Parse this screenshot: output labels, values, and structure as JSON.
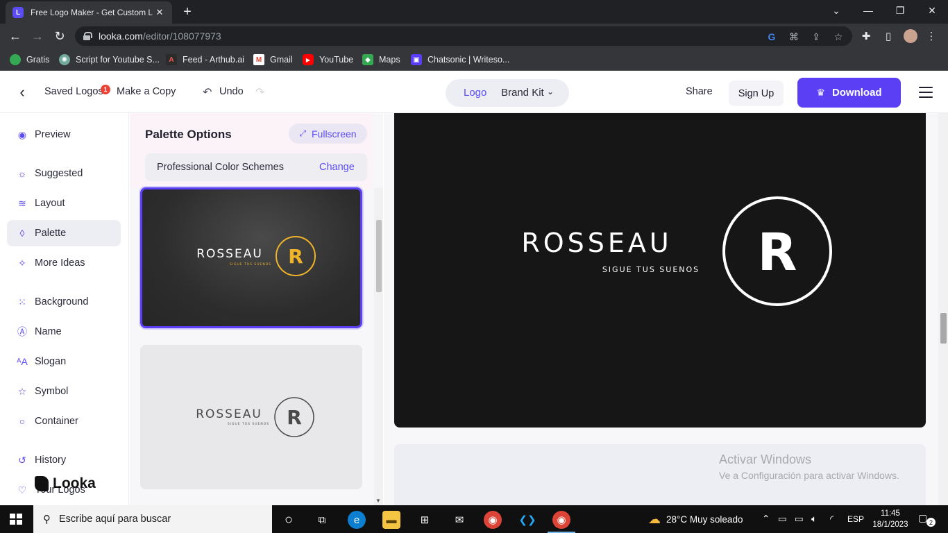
{
  "browser": {
    "tab_title": "Free Logo Maker - Get Custom L",
    "url_domain": "looka.com",
    "url_path": "/editor/108077973",
    "bookmarks": [
      {
        "label": "Gratis",
        "icon": "green-dot-icon",
        "color": "#34a853"
      },
      {
        "label": "Script for Youtube S...",
        "icon": "openai-icon",
        "color": "#74aa9c"
      },
      {
        "label": "Feed - Arthub.ai",
        "icon": "arthub-icon",
        "color": "#c62828"
      },
      {
        "label": "Gmail",
        "icon": "gmail-icon",
        "color": "#ea4335"
      },
      {
        "label": "YouTube",
        "icon": "youtube-icon",
        "color": "#ff0000"
      },
      {
        "label": "Maps",
        "icon": "maps-icon",
        "color": "#34a853"
      },
      {
        "label": "Chatsonic | Writeso...",
        "icon": "chatsonic-icon",
        "color": "#5b3ff5"
      }
    ]
  },
  "header": {
    "saved_logos": "Saved Logos",
    "saved_badge": "1",
    "make_copy": "Make a Copy",
    "undo": "Undo",
    "tab_logo": "Logo",
    "tab_brand_kit": "Brand Kit",
    "share": "Share",
    "sign_up": "Sign Up",
    "download": "Download"
  },
  "sidebar": {
    "items": [
      {
        "label": "Preview",
        "icon": "eye-icon",
        "glyph": "◉"
      },
      {
        "label": "Suggested",
        "icon": "lightbulb-icon",
        "glyph": "☼"
      },
      {
        "label": "Layout",
        "icon": "layers-icon",
        "glyph": "≋"
      },
      {
        "label": "Palette",
        "icon": "droplet-icon",
        "glyph": "◊"
      },
      {
        "label": "More Ideas",
        "icon": "sparkle-icon",
        "glyph": "✧"
      },
      {
        "label": "Background",
        "icon": "grid-icon",
        "glyph": "⁙"
      },
      {
        "label": "Name",
        "icon": "text-box-icon",
        "glyph": "Ⓐ"
      },
      {
        "label": "Slogan",
        "icon": "font-icon",
        "glyph": "ᴬA"
      },
      {
        "label": "Symbol",
        "icon": "star-icon",
        "glyph": "☆"
      },
      {
        "label": "Container",
        "icon": "circle-icon",
        "glyph": "○"
      },
      {
        "label": "History",
        "icon": "history-icon",
        "glyph": "↺"
      },
      {
        "label": "Your Logos",
        "icon": "heart-icon",
        "glyph": "♡"
      }
    ],
    "brand": "Looka"
  },
  "palette": {
    "title": "Palette Options",
    "fullscreen": "Fullscreen",
    "scheme_label": "Professional Color Schemes",
    "scheme_change": "Change"
  },
  "logo": {
    "name": "ROSSEAU",
    "slogan": "SIGUE TUS SUENOS",
    "symbol": "R"
  },
  "watermark": {
    "title": "Activar Windows",
    "subtitle": "Ve a Configuración para activar Windows."
  },
  "taskbar": {
    "search_placeholder": "Escribe aquí para buscar",
    "weather": "28°C  Muy soleado",
    "language": "ESP",
    "time": "11:45",
    "date": "18/1/2023",
    "notifications": "2"
  }
}
